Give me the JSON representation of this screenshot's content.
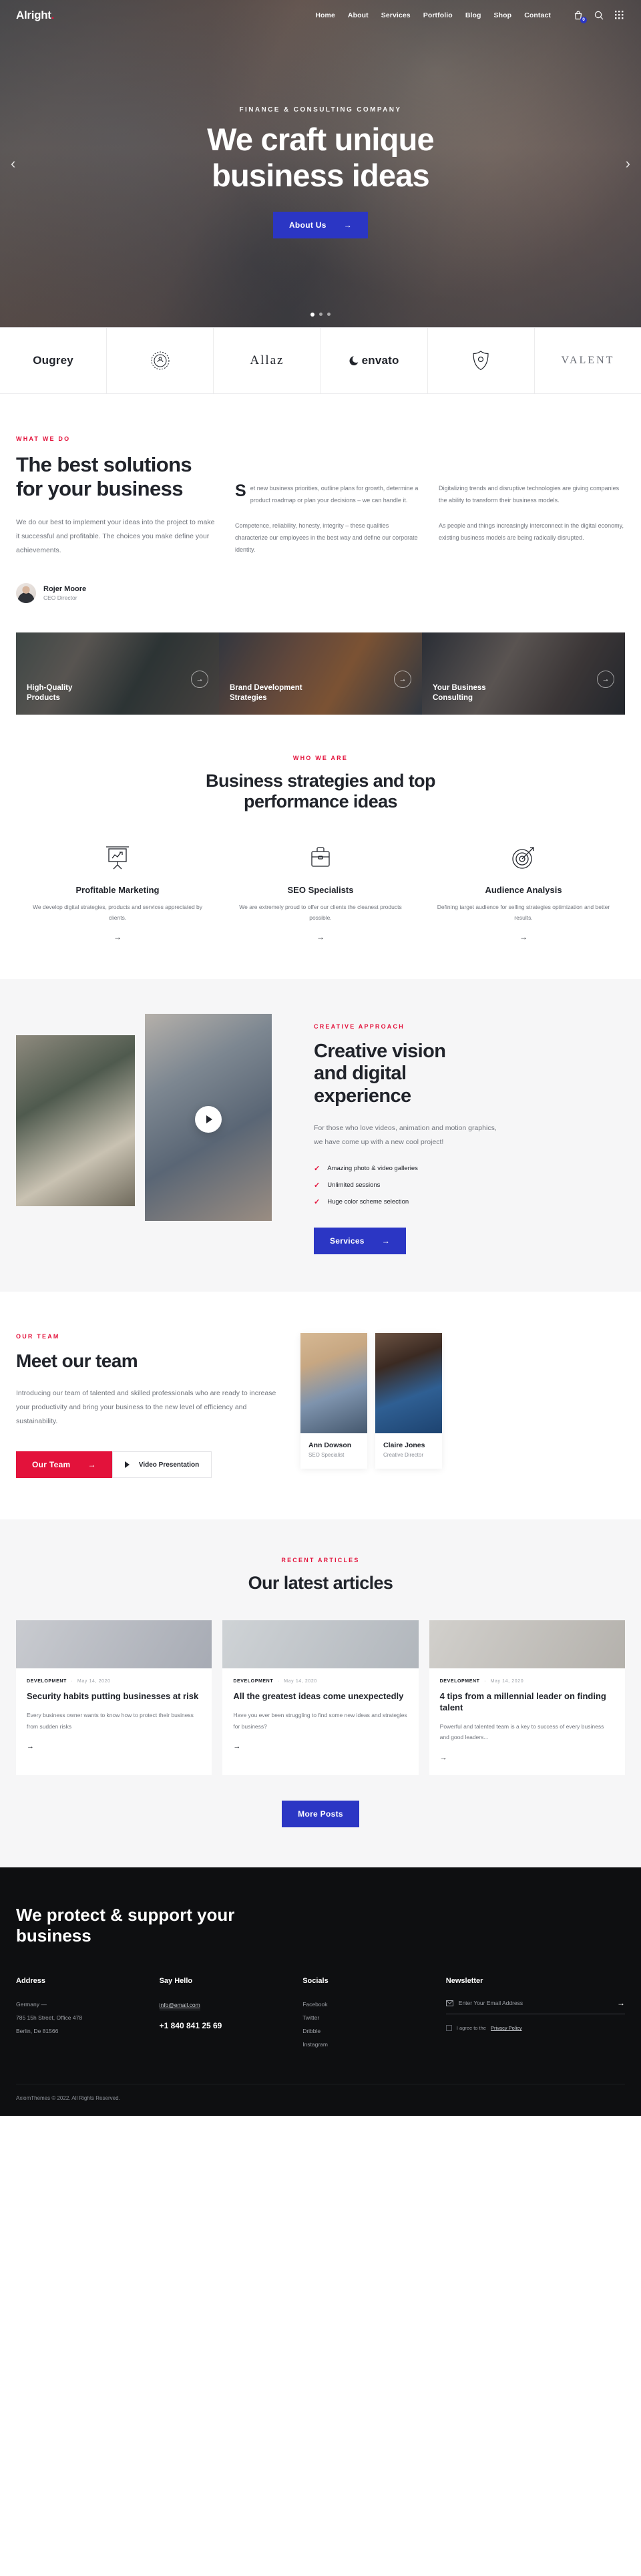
{
  "header": {
    "logo": "Alright",
    "logo_dot": ".",
    "nav": [
      {
        "label": "Home"
      },
      {
        "label": "About"
      },
      {
        "label": "Services"
      },
      {
        "label": "Portfolio"
      },
      {
        "label": "Blog"
      },
      {
        "label": "Shop"
      },
      {
        "label": "Contact"
      }
    ],
    "cart_count": "0",
    "icons": [
      "cart-icon",
      "search-icon",
      "grid-menu-icon"
    ]
  },
  "hero": {
    "eyebrow": "FINANCE & CONSULTING COMPANY",
    "title_line1": "We craft unique",
    "title_line2": "business ideas",
    "cta": "About Us",
    "arrow": "→",
    "prev": "‹",
    "next": "›"
  },
  "brands": [
    {
      "name": "Ougrey"
    },
    {
      "name": "crest-emblem"
    },
    {
      "name": "Allaz"
    },
    {
      "name": "envato"
    },
    {
      "name": "shield-mark"
    },
    {
      "name": "VALENT"
    }
  ],
  "what_we_do": {
    "eyebrow": "WHAT WE DO",
    "title": "The best solutions for your business",
    "lead": "We do our best to implement your ideas into the project to make it successful and profitable. The choices you make define your achievements.",
    "person_name": "Rojer Moore",
    "person_role": "CEO Director",
    "col1_p1": "Set new business priorities, outline plans for growth, determine a product roadmap or plan your decisions – we can handle it.",
    "col1_p2": "Competence, reliability, honesty, integrity – these qualities characterize our employees in the best way and define our corporate identity.",
    "col2_p1": "Digitalizing trends and disruptive technologies are giving companies the ability to transform their business models.",
    "col2_p2": "As people and things increasingly interconnect in the digital economy, existing business models are being radically disrupted."
  },
  "cards3": [
    {
      "title": "High-Quality Products",
      "arrow": "→"
    },
    {
      "title": "Brand Development Strategies",
      "arrow": "→"
    },
    {
      "title": "Your Business Consulting",
      "arrow": "→"
    }
  ],
  "who_we_are": {
    "eyebrow": "WHO WE ARE",
    "title": "Business strategies and top performance ideas",
    "features": [
      {
        "icon": "presentation-chart-icon",
        "title": "Profitable Marketing",
        "desc": "We develop digital strategies, products and services appreciated by clients.",
        "arrow": "→"
      },
      {
        "icon": "briefcase-icon",
        "title": "SEO Specialists",
        "desc": "We are extremely proud to offer our clients the cleanest products possible.",
        "arrow": "→"
      },
      {
        "icon": "target-dart-icon",
        "title": "Audience Analysis",
        "desc": "Defining target audience for selling strategies optimization and better results.",
        "arrow": "→"
      }
    ]
  },
  "creative": {
    "eyebrow": "CREATIVE APPROACH",
    "title": "Creative vision and digital experience",
    "lead": "For those who love videos, animation and motion graphics, we have come up with a new cool project!",
    "checks": [
      "Amazing photo & video galleries",
      "Unlimited sessions",
      "Huge color scheme selection"
    ],
    "cta": "Services",
    "arrow": "→"
  },
  "team": {
    "eyebrow": "OUR TEAM",
    "title": "Meet our team",
    "lead": "Introducing our team of talented and skilled professionals who are ready to increase your productivity and bring your business to the new level of efficiency and sustainability.",
    "cta": "Our Team",
    "arrow": "→",
    "video_label": "Video Presentation",
    "members": [
      {
        "name": "Ann Dowson",
        "role": "SEO Specialist"
      },
      {
        "name": "Claire Jones",
        "role": "Creative Director"
      }
    ]
  },
  "articles": {
    "eyebrow": "RECENT ARTICLES",
    "title": "Our latest articles",
    "more": "More Posts",
    "arrow": "→",
    "items": [
      {
        "category": "DEVELOPMENT",
        "date": "May 14, 2020",
        "title": "Security habits putting businesses at risk",
        "excerpt": "Every business owner wants to know how to protect their business from sudden risks",
        "arrow": "→"
      },
      {
        "category": "DEVELOPMENT",
        "date": "May 14, 2020",
        "title": "All the greatest ideas come unexpectedly",
        "excerpt": "Have you ever been struggling to find some new ideas and strategies for business?",
        "arrow": "→"
      },
      {
        "category": "DEVELOPMENT",
        "date": "May 14, 2020",
        "title": "4 tips from a millennial leader on finding talent",
        "excerpt": "Powerful and talented team is a key to success of every business and good leaders...",
        "arrow": "→"
      }
    ]
  },
  "footer": {
    "title": "We protect & support your business",
    "address": {
      "heading": "Address",
      "line1": "Germany —",
      "line2": "785 15h Street, Office 478",
      "line3": "Berlin, De 81566"
    },
    "say_hello": {
      "heading": "Say Hello",
      "email": "info@email.com",
      "phone": "+1 840 841 25 69"
    },
    "socials": {
      "heading": "Socials",
      "items": [
        "Facebook",
        "Twitter",
        "Dribble",
        "Instagram"
      ]
    },
    "newsletter": {
      "heading": "Newsletter",
      "placeholder": "Enter Your Email Address",
      "value": "",
      "send_arrow": "→",
      "agree_prefix": "I agree to the ",
      "agree_link": "Privacy Policy"
    },
    "copyright": "AxiomThemes © 2022. All Rights Reserved."
  },
  "colors": {
    "accent_red": "#e3123b",
    "accent_blue": "#2b36c4",
    "dark": "#21242b",
    "footer_bg": "#0e0f11"
  }
}
